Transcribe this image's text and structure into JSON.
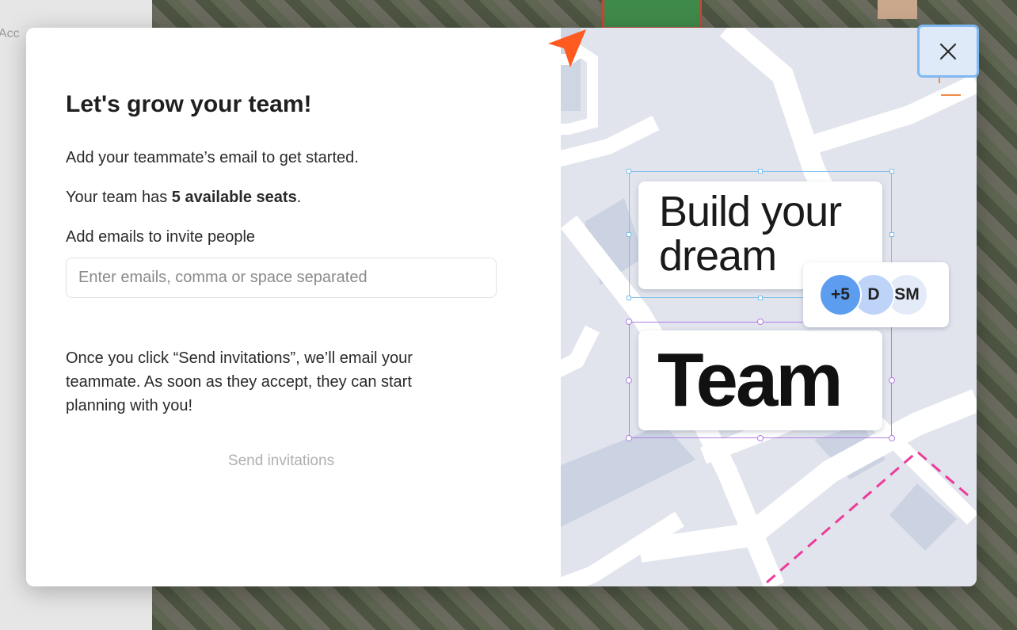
{
  "background": {
    "left_text": "Acc"
  },
  "modal": {
    "title": "Let's grow your team!",
    "intro": "Add your teammate’s email to get started.",
    "seats_prefix": "Your team has ",
    "seats_bold": "5 available seats",
    "seats_suffix": ".",
    "invite_label": "Add emails to invite people",
    "email_input": {
      "value": "",
      "placeholder": "Enter emails, comma or space separated"
    },
    "info_text": "Once you click “Send invitations”, we’ll email your teammate. As soon as they accept, they can start planning with you!",
    "send_button": "Send invitations",
    "send_button_state": "disabled"
  },
  "illustration": {
    "card1_line1": "Build your",
    "card1_line2": "dream",
    "card2_text": "Team",
    "avatars": [
      "+5",
      "D",
      "SM"
    ],
    "colors": {
      "blue_selection": "#7ec0ec",
      "purple_selection": "#b07ee6",
      "cursor": "#ff5a1f",
      "route_dashes": "#ee3a9a",
      "avatar_primary": "#5c9df0"
    }
  },
  "close_button": {
    "icon": "close-icon"
  }
}
